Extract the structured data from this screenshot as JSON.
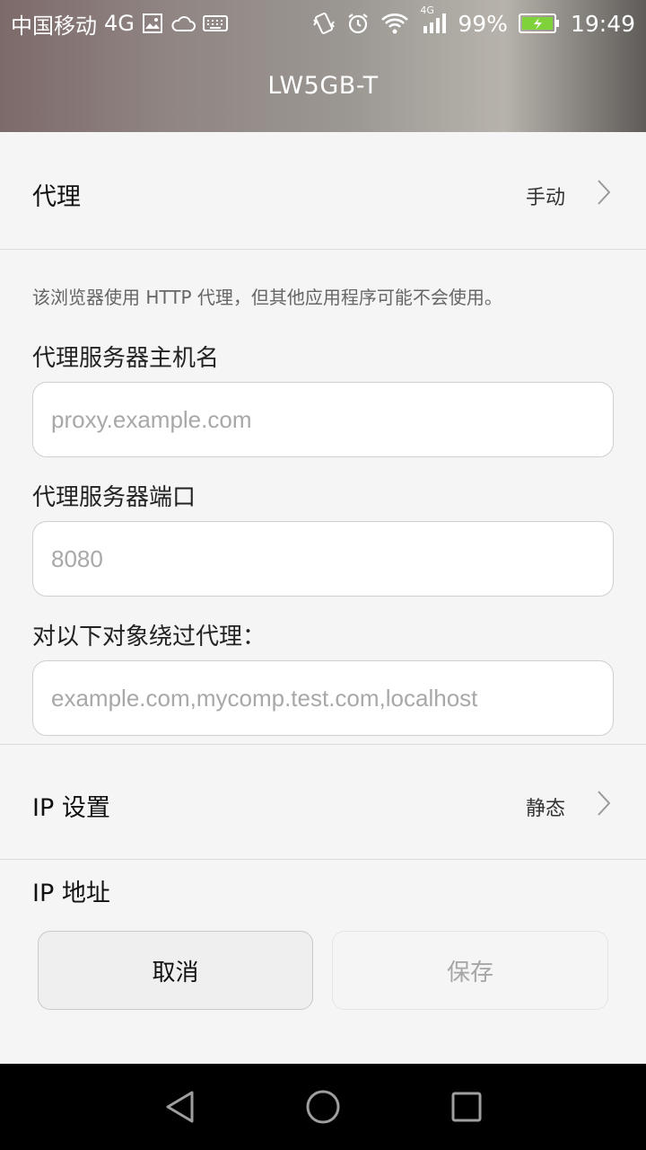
{
  "status_bar": {
    "carrier": "中国移动",
    "network": "4G",
    "network_small": "4G",
    "battery": "99%",
    "time": "19:49",
    "icons": [
      "gallery-icon",
      "cloud-icon",
      "keyboard-icon",
      "vibrate-icon",
      "alarm-icon",
      "wifi-icon",
      "signal-icon",
      "battery-charging-icon"
    ]
  },
  "header": {
    "title": "LW5GB-T"
  },
  "proxy": {
    "label": "代理",
    "value": "手动"
  },
  "note": "该浏览器使用 HTTP 代理，但其他应用程序可能不会使用。",
  "hostname": {
    "label": "代理服务器主机名",
    "placeholder": "proxy.example.com",
    "value": ""
  },
  "port": {
    "label": "代理服务器端口",
    "placeholder": "8080",
    "value": ""
  },
  "bypass": {
    "label": "对以下对象绕过代理：",
    "placeholder": "example.com,mycomp.test.com,localhost",
    "value": ""
  },
  "ip_settings": {
    "label": "IP 设置",
    "value": "静态"
  },
  "ip_address": {
    "label": "IP 地址"
  },
  "buttons": {
    "cancel": "取消",
    "save": "保存"
  },
  "nav": {
    "icons": [
      "back-icon",
      "home-icon",
      "recents-icon"
    ]
  },
  "colors": {
    "accent_battery": "#7fd23a",
    "header_gradient_mid": "#9c9893"
  }
}
